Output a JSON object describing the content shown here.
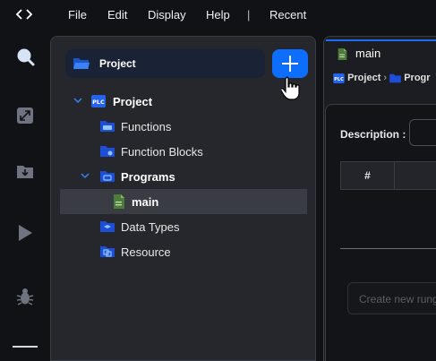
{
  "menubar": {
    "items": [
      "File",
      "Edit",
      "Display",
      "Help",
      "|",
      "Recent"
    ]
  },
  "explorer": {
    "header_label": "Project",
    "tree": [
      {
        "label": "Project",
        "bold": true,
        "icon": "plc-icon",
        "expanded": true
      },
      {
        "label": "Functions",
        "bold": false,
        "icon": "functions-folder-icon"
      },
      {
        "label": "Function Blocks",
        "bold": false,
        "icon": "function-blocks-folder-icon"
      },
      {
        "label": "Programs",
        "bold": true,
        "icon": "programs-folder-icon",
        "expanded": true
      },
      {
        "label": "main",
        "bold": true,
        "icon": "program-file-icon",
        "selected": true
      },
      {
        "label": "Data Types",
        "bold": false,
        "icon": "data-types-folder-icon"
      },
      {
        "label": "Resource",
        "bold": false,
        "icon": "resource-folder-icon"
      }
    ]
  },
  "editor": {
    "tab_label": "main",
    "breadcrumb": [
      "Project",
      "Progr"
    ],
    "description_label": "Description :",
    "table_header": "#",
    "new_rung_placeholder": "Create new rung"
  },
  "colors": {
    "accent": "#0d6efd",
    "background": "#111216",
    "panel": "#26272d"
  }
}
